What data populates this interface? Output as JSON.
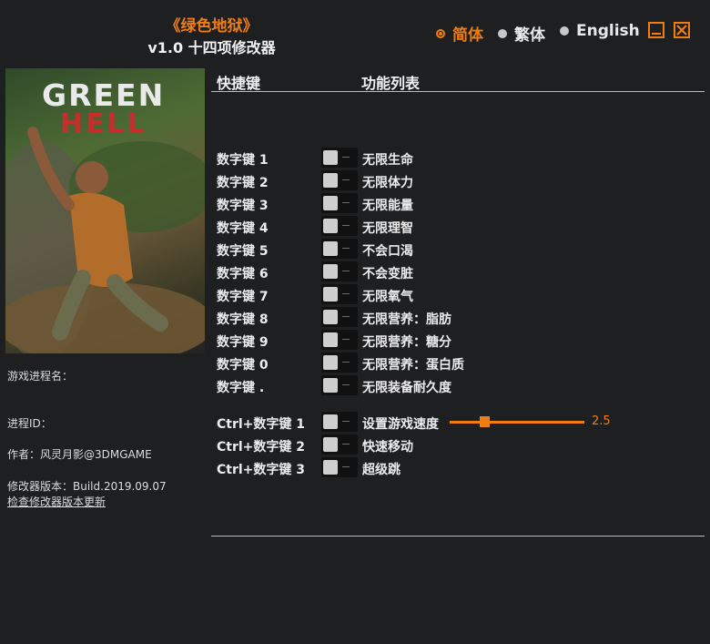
{
  "header": {
    "title": "《绿色地狱》",
    "subtitle": "v1.0 十四项修改器"
  },
  "languages": [
    {
      "label": "简体",
      "selected": true
    },
    {
      "label": "繁体",
      "selected": false
    },
    {
      "label": "English",
      "selected": false
    }
  ],
  "cover": {
    "logo_line1": "GREEN",
    "logo_line2": "HELL"
  },
  "info": {
    "process_name_label": "游戏进程名：",
    "process_id_label": "进程ID：",
    "author": "作者：风灵月影@3DMGAME",
    "version": "修改器版本：Build.2019.09.07",
    "update_link": "检查修改器版本更新"
  },
  "columns": {
    "hotkey": "快捷键",
    "function": "功能列表"
  },
  "cheats": [
    {
      "key": "数字键 1",
      "label": "无限生命"
    },
    {
      "key": "数字键 2",
      "label": "无限体力"
    },
    {
      "key": "数字键 3",
      "label": "无限能量"
    },
    {
      "key": "数字键 4",
      "label": "无限理智"
    },
    {
      "key": "数字键 5",
      "label": "不会口渴"
    },
    {
      "key": "数字键 6",
      "label": "不会变脏"
    },
    {
      "key": "数字键 7",
      "label": "无限氧气"
    },
    {
      "key": "数字键 8",
      "label": "无限营养：脂肪"
    },
    {
      "key": "数字键 9",
      "label": "无限营养：糖分"
    },
    {
      "key": "数字键 0",
      "label": "无限营养：蛋白质"
    },
    {
      "key": "数字键 .",
      "label": "无限装备耐久度"
    }
  ],
  "ctrl_cheats": [
    {
      "key": "Ctrl+数字键 1",
      "label": "设置游戏速度"
    },
    {
      "key": "Ctrl+数字键 2",
      "label": "快速移动"
    },
    {
      "key": "Ctrl+数字键 3",
      "label": "超级跳"
    }
  ],
  "speed_slider": {
    "value": "2.5",
    "fraction": 0.26
  },
  "colors": {
    "accent": "#f07d10",
    "background": "#1e1f21"
  }
}
